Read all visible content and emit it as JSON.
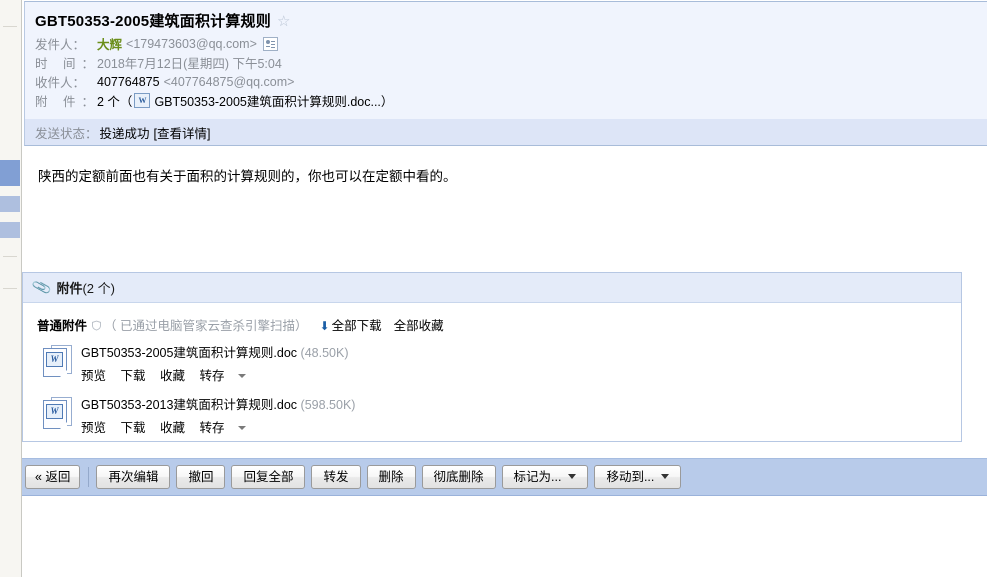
{
  "window": {
    "app": "QQ Mail Reading Pane"
  },
  "nav_rail": {
    "name": "folder-list-rail"
  },
  "mail": {
    "subject": "GBT50353-2005建筑面积计算规则",
    "star_icon": "star-outline-icon",
    "fields": {
      "from_label": "发件人：",
      "from_name": "大辉",
      "from_address": "<179473603@qq.com>",
      "contact_card_icon": "contact-card-icon",
      "time_label": "时  间：",
      "time_value": "2018年7月12日(星期四) 下午5:04",
      "to_label": "收件人：",
      "to_name": "407764875",
      "to_address": "<407764875@qq.com>",
      "attach_label": "附  件：",
      "attach_count_text": "2 个（",
      "attach_doc_icon": "word-doc-icon",
      "attach_preview_name": "GBT50353-2005建筑面积计算规则.doc...）"
    },
    "status": {
      "label": "发送状态：",
      "value": "投递成功",
      "detail_link": "[查看详情]"
    },
    "body_text": "陕西的定额前面也有关于面积的计算规则的，你也可以在定额中看的。"
  },
  "attachments": {
    "panel_icon": "paperclip-icon",
    "panel_title": "附件",
    "panel_count": "(2 个)",
    "group_title": "普通附件",
    "scan_icon": "shield-check-icon",
    "scan_note": "（ 已通过电脑管家云查杀引擎扫描）",
    "download_all_icon": "download-arrow-icon",
    "download_all": "全部下载",
    "favorite_all": "全部收藏",
    "actions": [
      "预览",
      "下载",
      "收藏",
      "转存"
    ],
    "action_caret_icon": "caret-down-icon",
    "files": [
      {
        "icon": "word-doc-icon",
        "name": "GBT50353-2005建筑面积计算规则.doc",
        "size": "(48.50K)"
      },
      {
        "icon": "word-doc-icon",
        "name": "GBT50353-2013建筑面积计算规则.doc",
        "size": "(598.50K)"
      }
    ]
  },
  "toolbar": {
    "back": "« 返回",
    "buttons": [
      {
        "label": "再次编辑",
        "caret": false
      },
      {
        "label": "撤回",
        "caret": false
      },
      {
        "label": "回复全部",
        "caret": false
      },
      {
        "label": "转发",
        "caret": false
      },
      {
        "label": "删除",
        "caret": false
      },
      {
        "label": "彻底删除",
        "caret": false
      },
      {
        "label": "标记为...",
        "caret": true
      },
      {
        "label": "移动到...",
        "caret": true
      }
    ]
  },
  "colors": {
    "header_bg": "#f0f4fd",
    "status_bg": "#dde5f7",
    "toolbar_bg": "#b8cbea",
    "panel_border": "#b6c7e3",
    "sender_green": "#6b8e1a",
    "muted_text": "#8a8f97",
    "rail_selected": "#819fd4"
  }
}
